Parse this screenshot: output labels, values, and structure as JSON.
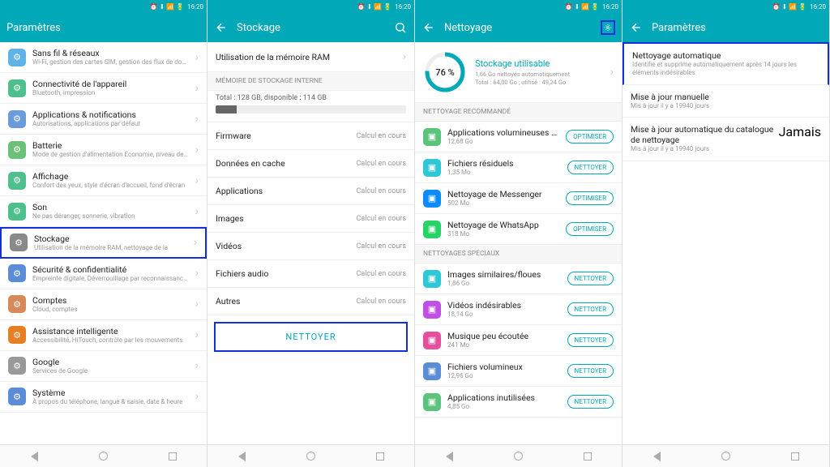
{
  "status": {
    "time": "16:20",
    "icons": "⏰ ⬇ 📶 🔋"
  },
  "icon_colors": {
    "wifi": "#5fb3e6",
    "device": "#4fc08d",
    "apps": "#6b9bd8",
    "battery": "#6bc17a",
    "display": "#4fc08d",
    "sound": "#4fc08d",
    "storage": "#8a8a8a",
    "security": "#5a8dd6",
    "accounts": "#d68a5a",
    "assist": "#e67e22",
    "google": "#999",
    "system": "#5a8dd6",
    "bulky": "#5cc47a",
    "residual": "#2ec7d6",
    "messenger": "#0a8cff",
    "whatsapp": "#25d366",
    "simimg": "#2ec7d6",
    "badvid": "#c04fe6",
    "music": "#e64f9c",
    "bigfiles": "#5a8dd6",
    "unused": "#5cc47a"
  },
  "screen1": {
    "title": "Paramètres",
    "items": [
      {
        "k": "wifi",
        "title": "Sans fil & réseaux",
        "sub": "Wi-Fi, gestion des cartes SIM, gestion des flux de données"
      },
      {
        "k": "device",
        "title": "Connectivité de l'appareil",
        "sub": "Bluetooth, impression"
      },
      {
        "k": "apps",
        "title": "Applications & notifications",
        "sub": "Autorisations, applications par défaut"
      },
      {
        "k": "battery",
        "title": "Batterie",
        "sub": "Mode de gestion d'alimentation Économie, niveau de consommation"
      },
      {
        "k": "display",
        "title": "Affichage",
        "sub": "Confort des yeux, style d'écran d'accueil, fond d'écran"
      },
      {
        "k": "sound",
        "title": "Son",
        "sub": "Ne pas déranger, sonnerie, vibration"
      },
      {
        "k": "storage",
        "title": "Stockage",
        "sub": "Utilisation de la mémoire RAM, nettoyage de la",
        "hl": true
      },
      {
        "k": "security",
        "title": "Sécurité & confidentialité",
        "sub": "Empreinte digitale, Déverrouillage par reconnaissance faciale, écran de verrouillage & mots de passe"
      },
      {
        "k": "accounts",
        "title": "Comptes",
        "sub": "Cloud, comptes"
      },
      {
        "k": "assist",
        "title": "Assistance intelligente",
        "sub": "Accessibilité, HiTouch, contrôle par les mouvements"
      },
      {
        "k": "google",
        "title": "Google",
        "sub": "Services de Google"
      },
      {
        "k": "system",
        "title": "Système",
        "sub": "À propos du téléphone, langue & saisie, date & heure"
      }
    ]
  },
  "screen2": {
    "title": "Stockage",
    "ram_label": "Utilisation de la mémoire RAM",
    "section": "MÉMOIRE DE STOCKAGE INTERNE",
    "total": "Total : 128 GB, disponible : 114 GB",
    "rows": [
      {
        "label": "Firmware",
        "val": "Calcul en cours"
      },
      {
        "label": "Données en cache",
        "val": "Calcul en cours"
      },
      {
        "label": "Applications",
        "val": "Calcul en cours"
      },
      {
        "label": "Images",
        "val": "Calcul en cours"
      },
      {
        "label": "Vidéos",
        "val": "Calcul en cours"
      },
      {
        "label": "Fichiers audio",
        "val": "Calcul en cours"
      },
      {
        "label": "Autres",
        "val": "Calcul en cours"
      }
    ],
    "clean_btn": "NETTOYER"
  },
  "screen3": {
    "title": "Nettoyage",
    "gauge_pct": "76 %",
    "gauge_title": "Stockage utilisable",
    "gauge_sub1": "1,66 Go nettoyés automatiquement",
    "gauge_sub2": "Total : 64,00 Go ; utilisé : 49,24 Go",
    "sec1": "NETTOYAGE RECOMMANDÉ",
    "sec2": "NETTOYAGES SPÉCIAUX",
    "btn_opt": "OPTIMISER",
    "btn_clean": "NETTOYER",
    "rec": [
      {
        "k": "bulky",
        "title": "Applications volumineuses (...",
        "sub": "12,68 Go",
        "act": "opt"
      },
      {
        "k": "residual",
        "title": "Fichiers résiduels",
        "sub": "1,35 Mo",
        "act": "clean"
      },
      {
        "k": "messenger",
        "title": "Nettoyage de Messenger",
        "sub": "502 Mo",
        "act": "opt"
      },
      {
        "k": "whatsapp",
        "title": "Nettoyage de WhatsApp",
        "sub": "318 Mo",
        "act": "opt"
      }
    ],
    "spec": [
      {
        "k": "simimg",
        "title": "Images similaires/floues",
        "sub": "1,86 Go",
        "act": "clean"
      },
      {
        "k": "badvid",
        "title": "Vidéos indésirables",
        "sub": "18,14 Go",
        "act": "clean"
      },
      {
        "k": "music",
        "title": "Musique peu écoutée",
        "sub": "241 Mo",
        "act": "clean"
      },
      {
        "k": "bigfiles",
        "title": "Fichiers volumineux",
        "sub": "12,96 Go",
        "act": "clean"
      },
      {
        "k": "unused",
        "title": "Applications inutilisées",
        "sub": "4,85 Go",
        "act": "clean"
      }
    ]
  },
  "screen4": {
    "title": "Paramètres",
    "items": [
      {
        "title": "Nettoyage automatique",
        "sub": "Identifie et supprime automatiquement après 14 jours les éléments indésirables",
        "hl": true
      },
      {
        "title": "Mise à jour manuelle",
        "sub": "Mis à jour il y a 19940 jours"
      },
      {
        "title": "Mise à jour automatique du catalogue de nettoyage",
        "sub": "Mis à jour il y a 19940 jours",
        "val": "Jamais"
      }
    ]
  }
}
